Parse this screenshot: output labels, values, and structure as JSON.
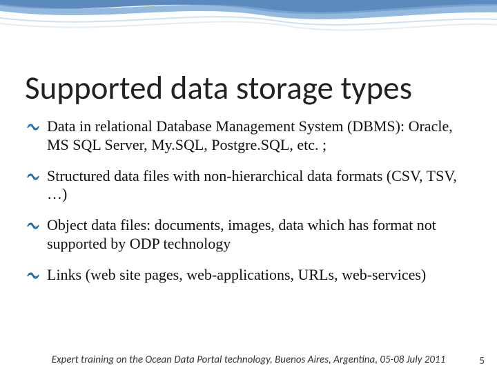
{
  "title": "Supported data storage types",
  "bullets": [
    "Data in relational Database Management System (DBMS): Oracle, MS SQL Server, My.SQL, Postgre.SQL, etc. ;",
    "Structured data files with non-hierarchical data formats (CSV, TSV, …)",
    "Object data files: documents, images, data which has format not supported by ODP technology",
    "Links (web site pages, web-applications, URLs, web-services)"
  ],
  "footer": "Expert training on the Ocean Data Portal technology, Buenos Aires, Argentina, 05-08 July 2011",
  "page_number": "5"
}
